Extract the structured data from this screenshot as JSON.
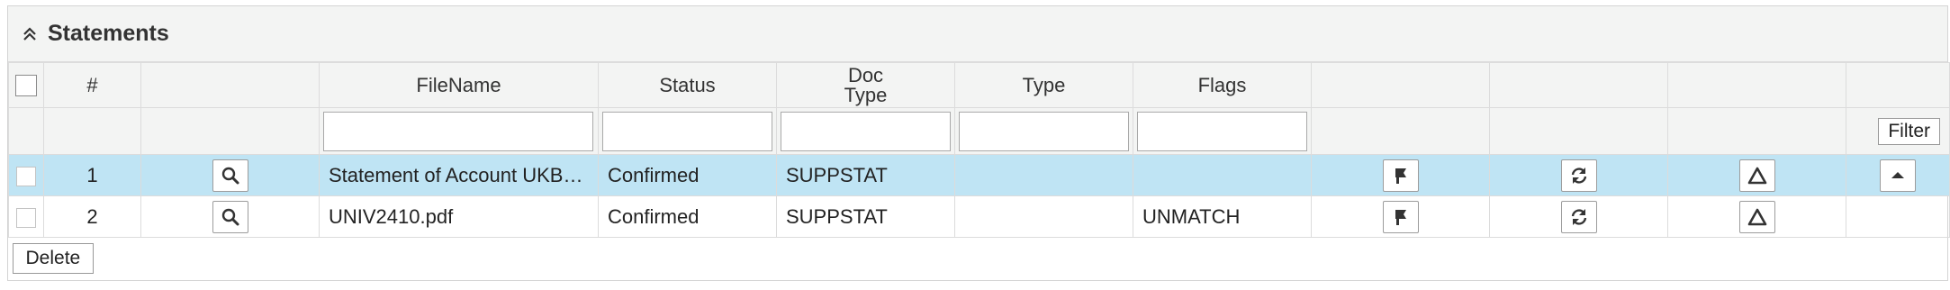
{
  "panel": {
    "title": "Statements"
  },
  "columns": {
    "num": "#",
    "filename": "FileName",
    "status": "Status",
    "doctype_line1": "Doc",
    "doctype_line2": "Type",
    "type": "Type",
    "flags": "Flags"
  },
  "filter": {
    "filename": "",
    "status": "",
    "doctype": "",
    "type": "",
    "flags": "",
    "button_label": "Filter"
  },
  "rows": [
    {
      "num": "1",
      "filename": "Statement of Account UKB…",
      "status": "Confirmed",
      "doctype": "SUPPSTAT",
      "type": "",
      "flags": "",
      "selected": true
    },
    {
      "num": "2",
      "filename": "UNIV2410.pdf",
      "status": "Confirmed",
      "doctype": "SUPPSTAT",
      "type": "",
      "flags": "UNMATCH",
      "selected": false
    }
  ],
  "footer": {
    "delete_label": "Delete"
  },
  "icons": {
    "collapse": "chevron-double-up-icon",
    "view": "magnifier-icon",
    "route": "flag-icon",
    "refresh": "refresh-icon",
    "warn": "triangle-icon",
    "sort": "caret-up-icon"
  },
  "colors": {
    "header_bg": "#f3f4f3",
    "selected_row_bg": "#bfe4f4",
    "border": "#dcdcdc"
  }
}
